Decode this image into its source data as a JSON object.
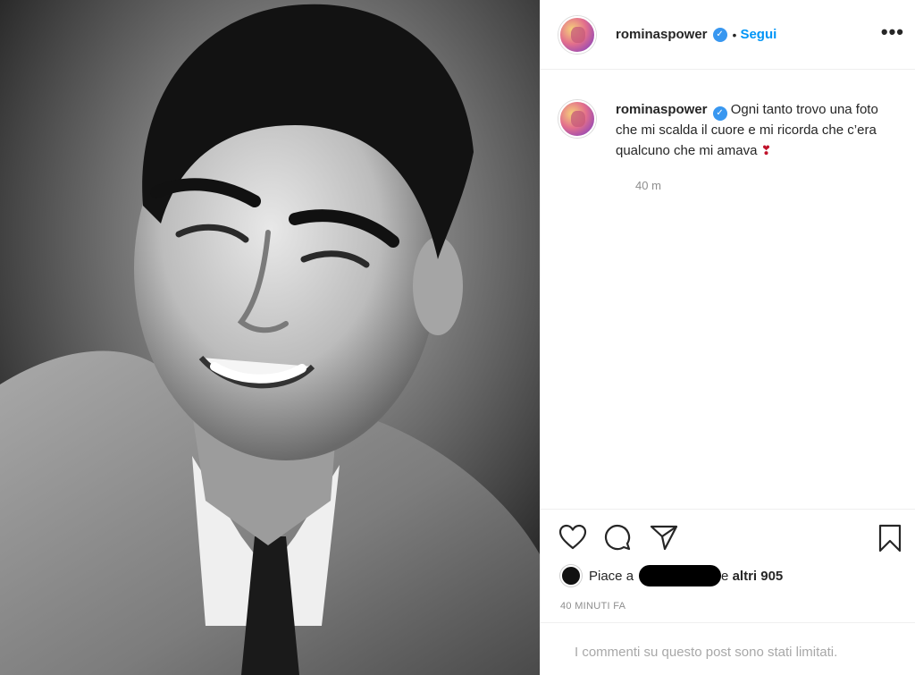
{
  "post": {
    "username": "rominaspower",
    "follow_label": "Segui",
    "dot": "•",
    "more_label": "•••",
    "verified_mark": "✓",
    "caption": "Ogni tanto trovo una foto che mi scalda il cuore e mi ricorda che c’era qualcuno che mi amava",
    "caption_emoji": "❣",
    "caption_time": "40 m",
    "likes_prefix": "Piace a",
    "likes_suffix": "e altri 905",
    "timestamp": "40 MINUTI FA",
    "comments_notice": "I commenti su questo post sono stati limitati."
  },
  "icons": {
    "like": "heart-outline-icon",
    "comment": "comment-bubble-icon",
    "share": "paper-plane-icon",
    "save": "bookmark-icon",
    "verified": "verified-badge-icon",
    "more": "more-options-icon"
  },
  "colors": {
    "accent": "#0095f6",
    "verified": "#3897f0",
    "text": "#262626",
    "muted": "#8e8e8e",
    "divider": "#efefef"
  }
}
